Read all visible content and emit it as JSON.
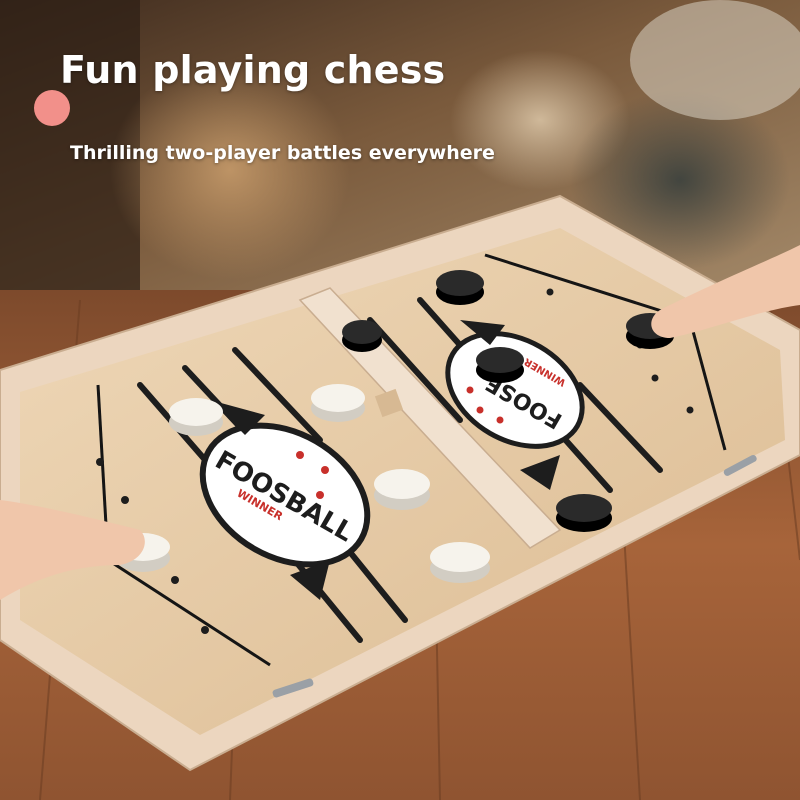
{
  "headline": "Fun playing chess",
  "subline": "Thrilling two-player battles everywhere",
  "board": {
    "logo_left": "FOOSBALL",
    "logo_right": "FOOSE",
    "badge": "WINNER"
  },
  "colors": {
    "accent_dot": "#f2908a",
    "wood_board": "#e6cba8",
    "frame": "#efd9c2",
    "table": "#9a5a32",
    "puck_dark": "#1c1c1c",
    "puck_light": "#f4f1ea"
  }
}
